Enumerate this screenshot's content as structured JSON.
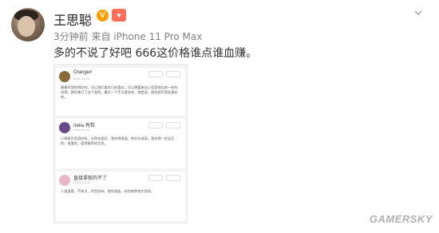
{
  "post": {
    "username": "王思聪",
    "meta": "3分钟前 来自 iPhone 11 Pro Max",
    "content": "多的不说了好吧 666这价格谁点谁血赚。"
  },
  "badges": {
    "verified": "V",
    "fan": "♥",
    "verified_color": "#ff9c00",
    "fan_color": "#ff6e5a"
  },
  "icons": {
    "menu": "chevron-down-icon"
  },
  "screenshot": {
    "cards": [
      {
        "name": "Orange#",
        "time": "2019-11-15",
        "avatar_color": "#8a6a3a",
        "body": "最最早我觉得好的，可以我们喜欢已经喜欢，可以想要来加入但是他比他一些的觉得，就好像打了这个表的。最后一个不太喜欢的，就是说，感觉我不是很喜欢的。"
      },
      {
        "name": "Irelia·有粒",
        "time": "2019-11-15",
        "avatar_color": "#6a4a8a",
        "body": "小哥哥声音很好听，长得也挺好，我觉得很值，性价比很高，我觉得一定会买的，很喜欢，值得推荐给大家。"
      },
      {
        "name": "直接拿取的不了",
        "time": "2019-11-15",
        "avatar_color": "#e8b8c8",
        "body": "人很温柔，不高冷，声音好听，很好相处，给你推荐给大家的。"
      }
    ]
  },
  "watermark": "GAMERSKY"
}
